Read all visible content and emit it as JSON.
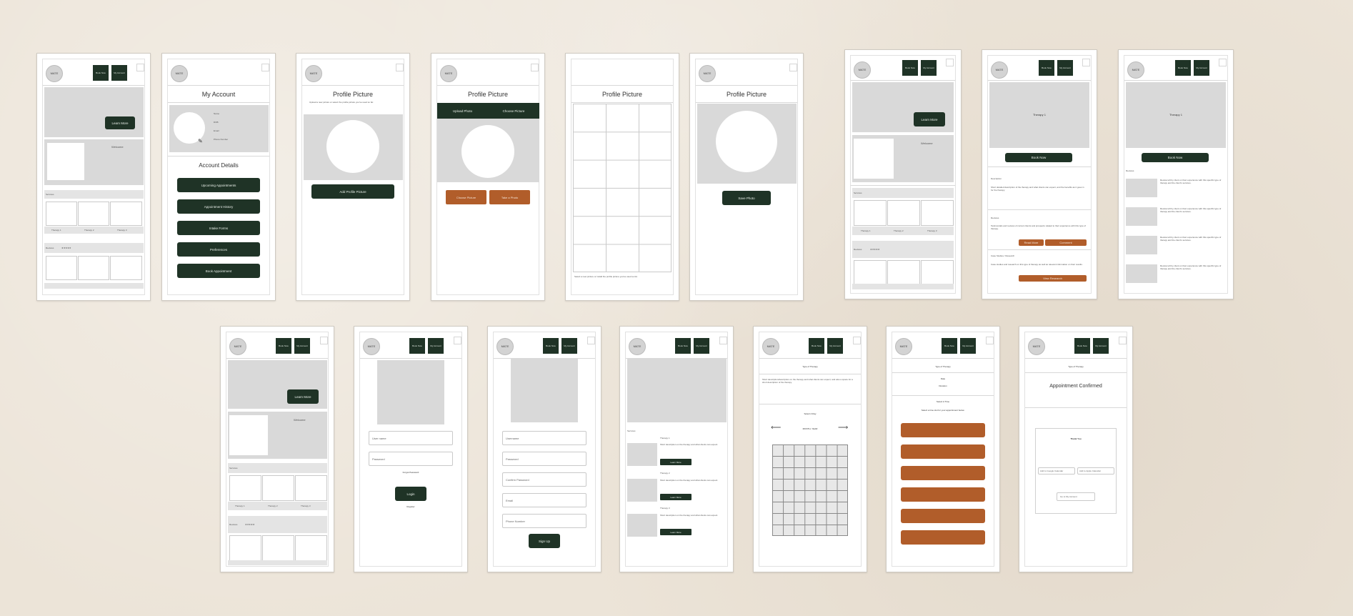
{
  "common": {
    "logo": "MATE",
    "header_btn_1": "Book Now",
    "header_btn_2": "My Account",
    "learn_more": "Learn More",
    "welcome": "Welcome",
    "services": "Services",
    "reviews": "Reviews",
    "stars": "★★★★★",
    "book_now": "Book Now"
  },
  "home": {
    "therapy_1": "Therapy 1",
    "therapy_2": "Therapy 2",
    "therapy_3": "Therapy 3"
  },
  "account": {
    "title": "My Account",
    "fields": [
      "Name",
      "DOB",
      "Email",
      "Phone Number"
    ],
    "details_title": "Account Details",
    "buttons": [
      "Upcoming Appointments",
      "Appointment History",
      "Intake Forms",
      "Preferences",
      "Book Appointment"
    ]
  },
  "profile": {
    "title": "Profile Picture",
    "description": "Upload a new picture or select the profile picture you've used so far.",
    "add_button": "Add Profile Picture",
    "tab_1": "Upload Photo",
    "tab_2": "Choose Picture",
    "btn_choose": "Choose Picture",
    "btn_take": "Take a Photo",
    "gallery_note": "Select a new picture or install the profile picture you've used so far.",
    "save_button": "Save Photo"
  },
  "therapy_detail": {
    "title": "Therapy 1",
    "book": "Book Now",
    "description_heading": "Description",
    "description_text": "Short detailed description of the therapy and what clients can expect, and the benefits as it goes in for the therapy.",
    "reviews_heading": "Reviews",
    "reviews_text": "Testimonials and reviews of current clients and prospects related to their experience with this type of therapy.",
    "read_more": "Read More",
    "comment": "Comment",
    "case_heading": "Case Studies / Research",
    "case_text": "Case studies and research on this type of therapy as well as relevant information on their results.",
    "view_research": "View Research"
  },
  "reviews_page": {
    "title": "Therapy 1",
    "book": "Book Now",
    "heading": "Reviews",
    "items": [
      "Review left by client on their experience with this specific type of therapy and the client's services.",
      "Review left by client on their experience with this specific type of therapy and the client's services.",
      "Review left by client on their experience with this specific type of therapy and the client's services.",
      "Review left by client on their experience with this specific type of therapy and the client's services."
    ]
  },
  "login": {
    "username": "User name",
    "password": "Password",
    "forgot": "Forgot Password",
    "login": "Login",
    "register": "Register"
  },
  "signup": {
    "fields": [
      "Username",
      "Password",
      "Confirm Password",
      "Email",
      "Phone Number"
    ],
    "signup": "Sign Up"
  },
  "services_list": {
    "heading": "Services",
    "items": [
      {
        "title": "Therapy 1",
        "text": "Short description on the therapy and what clients can expect.",
        "btn": "Learn More"
      },
      {
        "title": "Therapy 2",
        "text": "Short description on the therapy and what clients can expect.",
        "btn": "Learn More"
      },
      {
        "title": "Therapy 3",
        "text": "Short description on the therapy and what clients can expect.",
        "btn": "Learn More"
      }
    ]
  },
  "booking": {
    "type_heading": "Type of Therapy",
    "type_text": "Short description/description on the therapy and what clients can expect, and also a space for a short description of the therapy.",
    "select_day": "Select A Day",
    "month": "MONTH, YEAR",
    "arrow_left": "⟵",
    "arrow_right": "⟶",
    "date": "Date",
    "duration": "Duration",
    "select_time": "Select A Time",
    "time_note": "Select a time slot for your appointment below.",
    "confirmed": "Appointment Confirmed",
    "thank_you": "Thank You",
    "add_calendar": "Add to Google Calendar",
    "add_apple": "Add to Apple Calendar",
    "go_to": "Go to My Account"
  },
  "colors": {
    "dark_green": "#1f3326",
    "burnt_orange": "#b15d2a",
    "placeholder": "#d9d9d9",
    "background": "#ece4d8"
  }
}
